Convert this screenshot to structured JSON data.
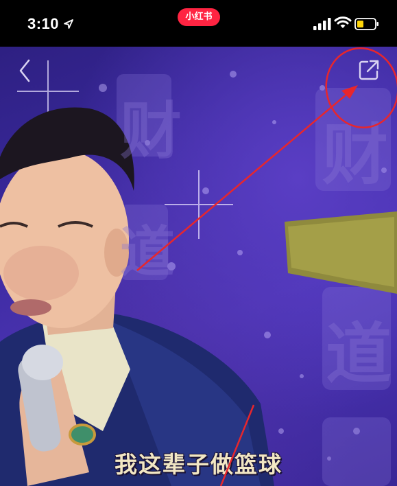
{
  "status_bar": {
    "time": "3:10",
    "app_badge": "小红书",
    "icons": [
      "location-arrow-icon",
      "cellular-signal-icon",
      "wifi-icon",
      "battery-icon"
    ],
    "badge_color": "#ff2442"
  },
  "video": {
    "nav": {
      "back_icon": "chevron-left-icon",
      "share_icon": "share-external-icon"
    },
    "subtitle": "我这辈子做篮球",
    "background_glyphs": [
      "财",
      "道",
      "财",
      "道"
    ]
  },
  "annotation": {
    "color": "#e8262c",
    "shapes": [
      "circle-highlight",
      "arrow-to-share-button"
    ]
  }
}
